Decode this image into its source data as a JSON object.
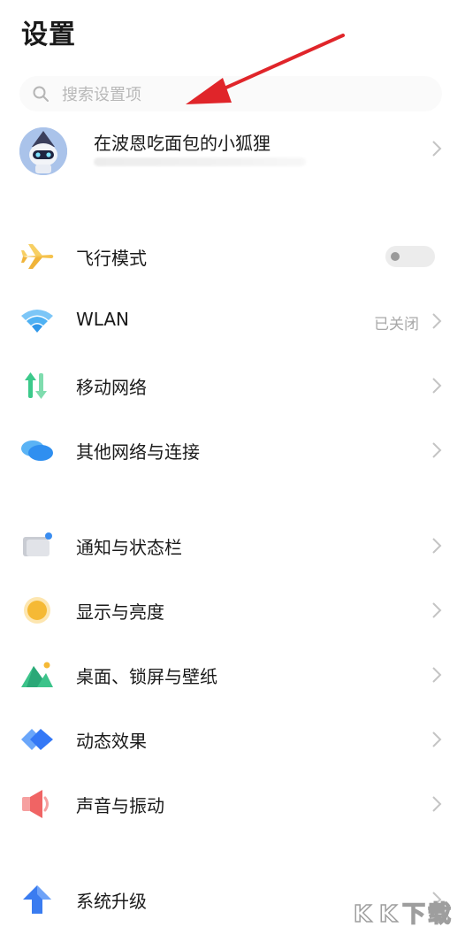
{
  "header": {
    "title": "设置"
  },
  "search": {
    "placeholder": "搜索设置项"
  },
  "profile": {
    "name": "在波恩吃面包的小狐狸"
  },
  "groups": [
    {
      "items": [
        {
          "label": "飞行模式",
          "icon": "airplane-icon",
          "control": "toggle",
          "toggle_on": false
        },
        {
          "label": "WLAN",
          "icon": "wifi-icon",
          "value": "已关闭"
        },
        {
          "label": "移动网络",
          "icon": "mobile-data-icon"
        },
        {
          "label": "其他网络与连接",
          "icon": "cloud-connection-icon"
        }
      ]
    },
    {
      "items": [
        {
          "label": "通知与状态栏",
          "icon": "notification-icon"
        },
        {
          "label": "显示与亮度",
          "icon": "brightness-icon"
        },
        {
          "label": "桌面、锁屏与壁纸",
          "icon": "wallpaper-icon"
        },
        {
          "label": "动态效果",
          "icon": "animation-effects-icon"
        },
        {
          "label": "声音与振动",
          "icon": "speaker-icon"
        }
      ]
    },
    {
      "items": [
        {
          "label": "系统升级",
          "icon": "system-upgrade-icon"
        }
      ]
    }
  ],
  "watermark": {
    "chars": [
      "K",
      "K",
      "下",
      "载"
    ]
  },
  "colors": {
    "airplane": "#f5c24c",
    "wifi": "#3fa4f0",
    "mobile_up": "#3cc98b",
    "cloud": "#2f8ff0",
    "brightness": "#f5b935",
    "wallpaper": "#3cc38a",
    "effects": "#3478f6",
    "speaker": "#f06464",
    "upgrade": "#3a7cf0",
    "annotation_arrow": "#e0252a"
  }
}
